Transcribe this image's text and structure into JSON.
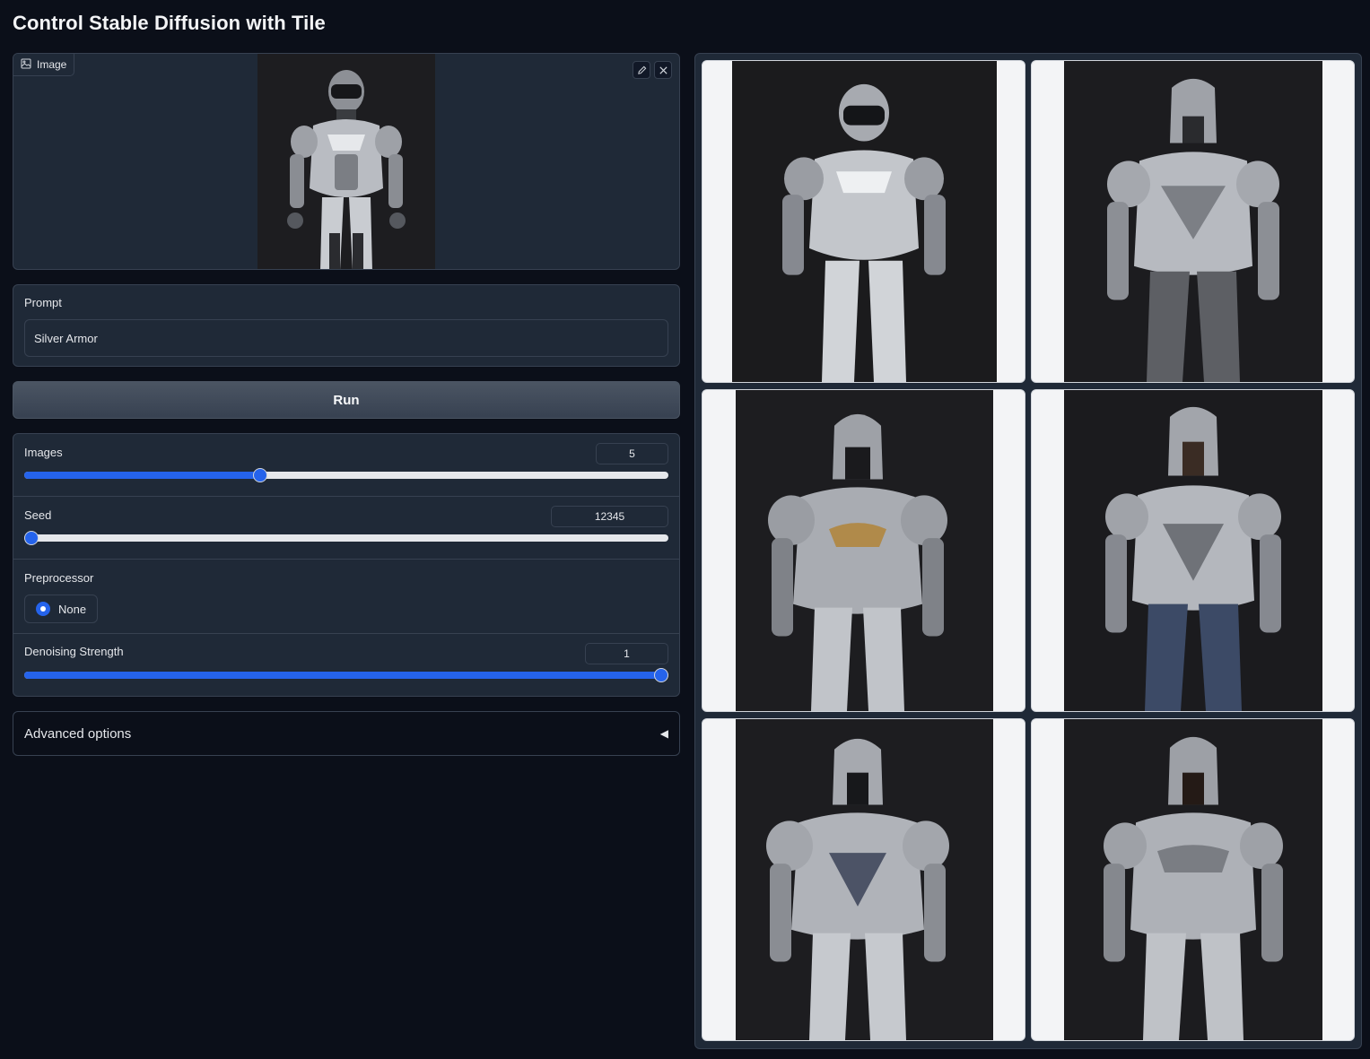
{
  "page": {
    "title": "Control Stable Diffusion with Tile"
  },
  "input_image": {
    "label": "Image",
    "edit_icon": "pencil-icon",
    "clear_icon": "close-icon"
  },
  "prompt": {
    "label": "Prompt",
    "value": "Silver Armor"
  },
  "run": {
    "label": "Run"
  },
  "settings": {
    "images": {
      "label": "Images",
      "value": "5",
      "fraction": 0.366
    },
    "seed": {
      "label": "Seed",
      "value": "12345",
      "fraction": 0.0
    },
    "preprocessor": {
      "label": "Preprocessor",
      "option": "None",
      "selected": true
    },
    "denoising": {
      "label": "Denoising Strength",
      "value": "1",
      "fraction": 1.0
    }
  },
  "advanced": {
    "label": "Advanced options",
    "icon": "caret-left-icon"
  },
  "colors": {
    "accent": "#2563eb",
    "background": "#0b0f19",
    "panel": "#1f2937",
    "border": "#374151"
  }
}
